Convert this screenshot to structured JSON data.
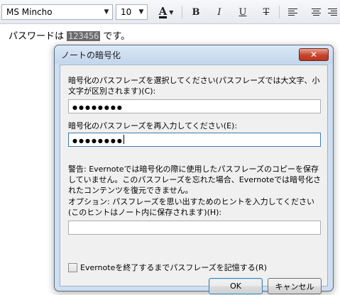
{
  "toolbar": {
    "font_name": "MS Mincho",
    "font_size": "10",
    "font_color_label": "A",
    "bold_label": "B",
    "italic_label": "I",
    "underline_label": "U",
    "strike_label": "T"
  },
  "document": {
    "text_before": "パスワードは",
    "encrypted_text": "123456",
    "text_after": "です。"
  },
  "dialog": {
    "title": "ノートの暗号化",
    "close_label": "✕",
    "passphrase_label": "暗号化のパスフレーズを選択してください(パスフレーズでは大文字、小文字が区別されます)(C):",
    "passphrase_value": "●●●●●●●●",
    "confirm_label": "暗号化のパスフレーズを再入力してください(E):",
    "confirm_value": "●●●●●●●●",
    "warning_text": "警告: Evernoteでは暗号化の際に使用したパスフレーズのコピーを保存していません。このパスフレーズを忘れた場合、Evernoteでは暗号化されたコンテンツを復元できません。",
    "hint_label": "オプション: パスフレーズを思い出すためのヒントを入力してください(このヒントはノート内に保存されます)(H):",
    "hint_value": "",
    "remember_label": "Evernoteを終了するまでパスフレーズを記憶する(R)",
    "ok_label": "OK",
    "cancel_label": "キャンセル"
  }
}
